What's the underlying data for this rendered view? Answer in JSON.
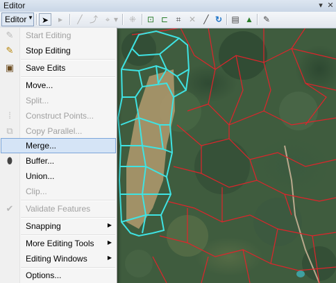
{
  "window": {
    "title": "Editor"
  },
  "toolbar": {
    "editor_label": "Editor",
    "tools": [
      {
        "icon": "pointer-arrow-icon",
        "enabled": true
      },
      {
        "icon": "edit-annotation-icon",
        "enabled": false
      },
      {
        "icon": "straight-segment-icon",
        "enabled": false
      },
      {
        "icon": "trace-icon",
        "enabled": false
      },
      {
        "icon": "point-icon",
        "enabled": false
      },
      {
        "icon": "edit-vertices-icon",
        "enabled": true
      },
      {
        "icon": "reshape-feature-icon",
        "enabled": true
      },
      {
        "icon": "cut-polygons-icon",
        "enabled": true
      },
      {
        "icon": "split-tool-icon",
        "enabled": false
      },
      {
        "icon": "rotate-icon",
        "enabled": true
      },
      {
        "icon": "attributes-icon",
        "enabled": true
      },
      {
        "icon": "sketch-properties-icon",
        "enabled": true
      },
      {
        "icon": "create-features-icon",
        "enabled": true
      }
    ]
  },
  "menu": {
    "items": [
      {
        "label": "Start Editing",
        "icon": "pencil-icon",
        "enabled": false
      },
      {
        "label": "Stop Editing",
        "icon": "stop-editing-icon",
        "enabled": true
      },
      {
        "label": "Save Edits",
        "icon": "save-icon",
        "enabled": true
      },
      {
        "label": "Move...",
        "enabled": true
      },
      {
        "label": "Split...",
        "enabled": false
      },
      {
        "label": "Construct Points...",
        "icon": "construct-points-icon",
        "enabled": false
      },
      {
        "label": "Copy Parallel...",
        "icon": "copy-parallel-icon",
        "enabled": false
      },
      {
        "label": "Merge...",
        "enabled": true,
        "highlighted": true
      },
      {
        "label": "Buffer...",
        "icon": "buffer-icon",
        "enabled": true
      },
      {
        "label": "Union...",
        "enabled": true
      },
      {
        "label": "Clip...",
        "enabled": false
      },
      {
        "label": "Validate Features",
        "icon": "validate-icon",
        "enabled": false
      },
      {
        "label": "Snapping",
        "enabled": true,
        "submenu": true
      },
      {
        "label": "More Editing Tools",
        "enabled": true,
        "submenu": true
      },
      {
        "label": "Editing Windows",
        "enabled": true,
        "submenu": true
      },
      {
        "label": "Options...",
        "enabled": true
      }
    ]
  },
  "colors": {
    "selection_outline": "#3fe3e3",
    "parcel_outline": "#e0242b",
    "menu_highlight": "#d5e4f6"
  }
}
